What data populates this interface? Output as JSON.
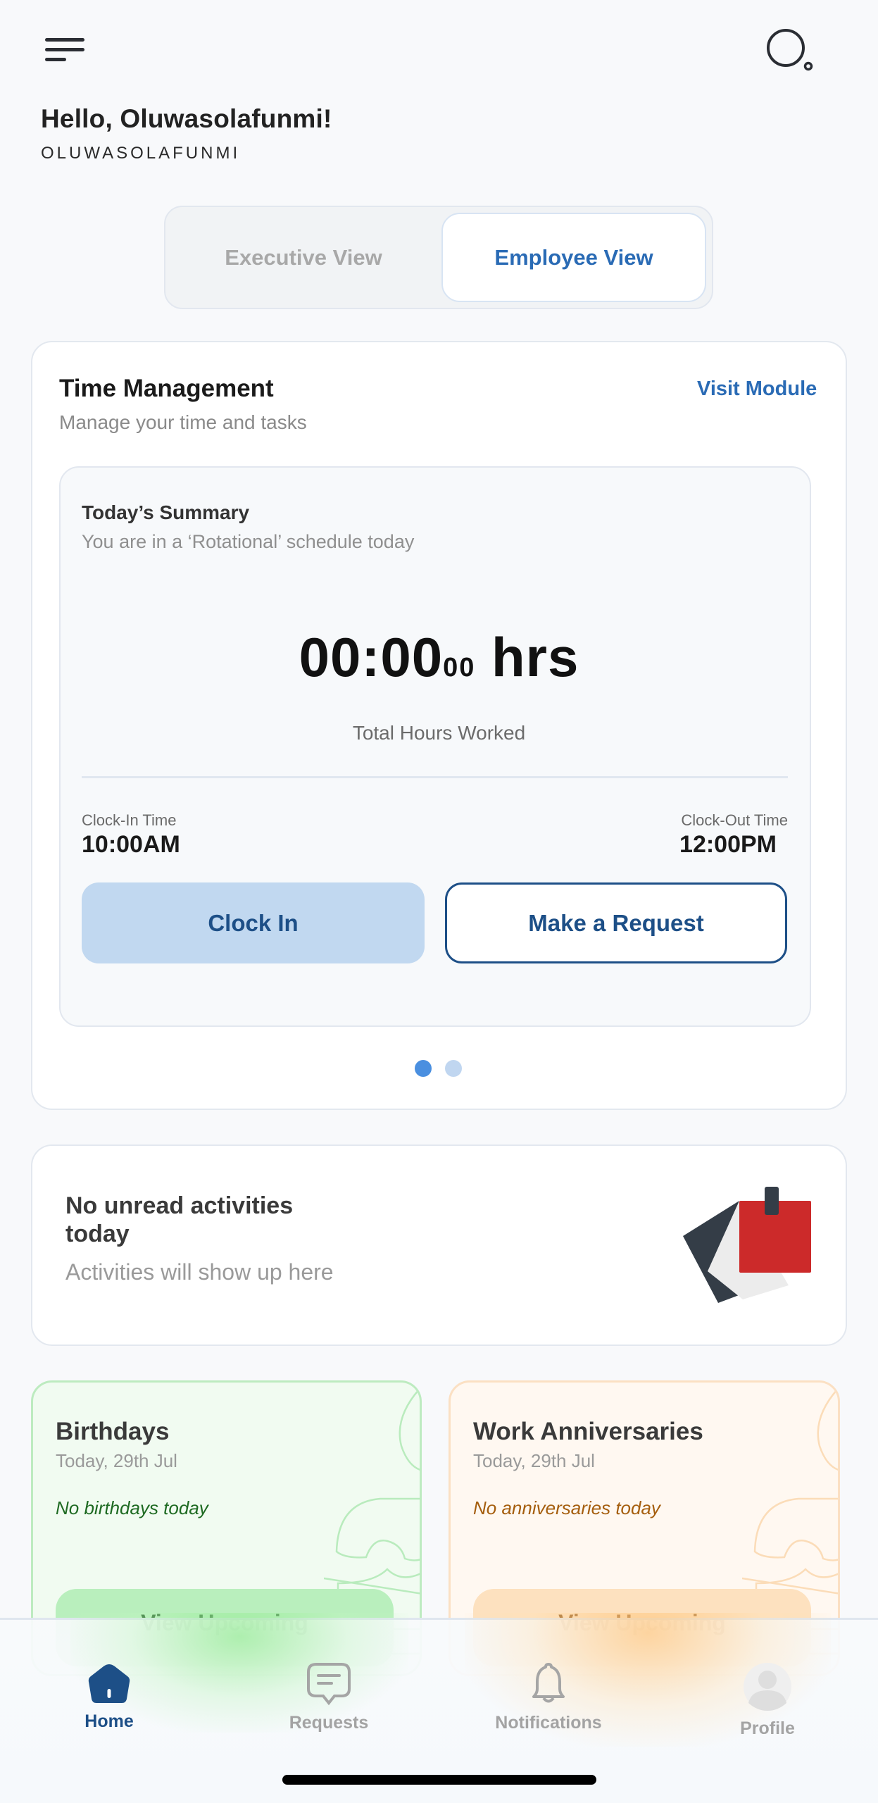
{
  "header": {
    "menu_icon": "hamburger-menu-icon",
    "search_icon": "search-icon",
    "greeting": "Hello, Oluwasolafunmi!",
    "username": "OLUWASOLAFUNMI"
  },
  "view_switch": {
    "options": [
      {
        "label": "Executive View",
        "selected": false
      },
      {
        "label": "Employee View",
        "selected": true
      }
    ]
  },
  "time_management": {
    "title": "Time Management",
    "subtitle": "Manage your time and tasks",
    "visit_link": "Visit Module",
    "summary": {
      "title": "Today’s Summary",
      "subtitle": "You are in a ‘Rotational’ schedule today",
      "hours_main": "00:00",
      "hours_small": "00",
      "hours_unit": "hrs",
      "hours_label": "Total Hours Worked",
      "clock_in_label": "Clock-In Time",
      "clock_in_value": "10:00AM",
      "clock_out_label": "Clock-Out Time",
      "clock_out_value": "12:00PM",
      "clock_in_button": "Clock In",
      "request_button": "Make a Request"
    },
    "carousel": {
      "total": 2,
      "active": 1
    }
  },
  "activities": {
    "title": "No unread activities today",
    "subtitle": "Activities will show up here",
    "illustration": "sticky-notes-illustration"
  },
  "birthdays": {
    "title": "Birthdays",
    "date": "Today, 29th Jul",
    "empty": "No birthdays today",
    "button": "View Upcoming"
  },
  "anniversaries": {
    "title": "Work Anniversaries",
    "date": "Today, 29th Jul",
    "empty": "No anniversaries today",
    "button": "View Upcoming"
  },
  "bottom_nav": {
    "items": [
      {
        "label": "Home",
        "icon": "home-icon",
        "active": true
      },
      {
        "label": "Requests",
        "icon": "chat-bubble-icon",
        "active": false
      },
      {
        "label": "Notifications",
        "icon": "bell-icon",
        "active": false
      },
      {
        "label": "Profile",
        "icon": "avatar-icon",
        "active": false
      }
    ]
  },
  "colors": {
    "primary": "#2a6bb5",
    "primary_dark": "#1d4f87",
    "birthday_accent": "#1e6a22",
    "anniversary_accent": "#a55e0e"
  }
}
